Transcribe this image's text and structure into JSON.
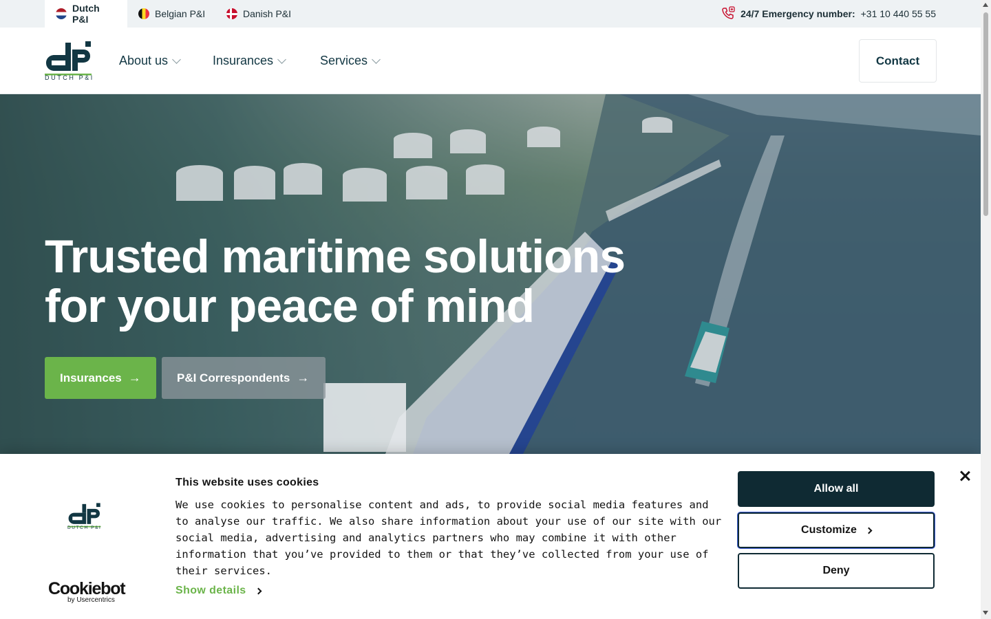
{
  "topbar": {
    "sites": [
      {
        "label": "Dutch P&I",
        "flag": "netherlands-flag-icon",
        "active": true
      },
      {
        "label": "Belgian P&I",
        "flag": "belgium-flag-icon",
        "active": false
      },
      {
        "label": "Danish P&I",
        "flag": "denmark-flag-icon",
        "active": false
      }
    ],
    "emergency": {
      "icon": "phone-medical-icon",
      "label": "24/7 Emergency number:",
      "number": "+31 10 440 55 55"
    }
  },
  "header": {
    "logo_text": "DUTCH P&I",
    "nav": [
      {
        "label": "About us"
      },
      {
        "label": "Insurances"
      },
      {
        "label": "Services"
      }
    ],
    "contact_label": "Contact"
  },
  "hero": {
    "title_line1": "Trusted maritime solutions",
    "title_line2": "for your peace of mind",
    "primary_button": "Insurances",
    "secondary_button": "P&I Correspondents"
  },
  "cookie_banner": {
    "logo_text": "DUTCH P&I",
    "provider_name": "Cookiebot",
    "provider_by": "by Usercentrics",
    "title": "This website uses cookies",
    "body": "We use cookies to personalise content and ads, to provide social media features and to analyse our traffic. We also share information about your use of our site with our social media, advertising and analytics partners who may combine it with other information that you’ve provided to them or that they’ve collected from your use of their services.",
    "show_details": "Show details",
    "allow_all": "Allow all",
    "customize": "Customize",
    "deny": "Deny"
  },
  "colors": {
    "brand_dark": "#0f2a33",
    "brand_green": "#6bb44a",
    "emergency_red": "#c8102e"
  }
}
